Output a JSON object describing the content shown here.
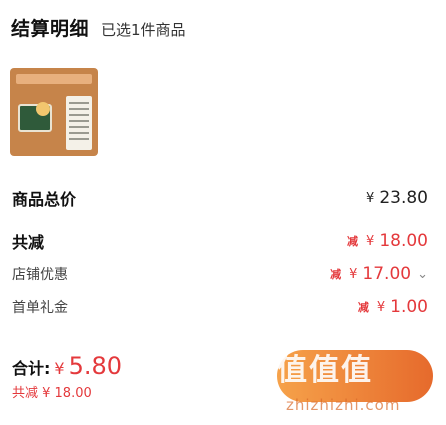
{
  "header": {
    "title": "结算明细",
    "selected": "已选1件商品"
  },
  "product": {
    "thumb_icon": "product-thumbnail"
  },
  "summary": {
    "goods_total": {
      "label": "商品总价",
      "currency": "¥",
      "amount": "23.80"
    },
    "total_discount": {
      "label": "共减",
      "tag": "减",
      "currency": "¥",
      "amount": "18.00"
    },
    "store_discount": {
      "label": "店铺优惠",
      "tag": "减",
      "currency": "¥",
      "amount": "17.00",
      "chevron": "⌄"
    },
    "first_order_gift": {
      "label": "首单礼金",
      "tag": "减",
      "currency": "¥",
      "amount": "1.00"
    }
  },
  "footer": {
    "total_label": "合计:",
    "total_currency": "¥",
    "total_amount": "5.80",
    "saved_text": "共减 ¥ 18.00"
  },
  "checkout": {
    "watermark": "值值值",
    "watermark_url": "zhizhizhi.com"
  },
  "colors": {
    "accent_red": "#e4393c",
    "button_start": "#f6a24a",
    "button_end": "#e66a2c"
  }
}
